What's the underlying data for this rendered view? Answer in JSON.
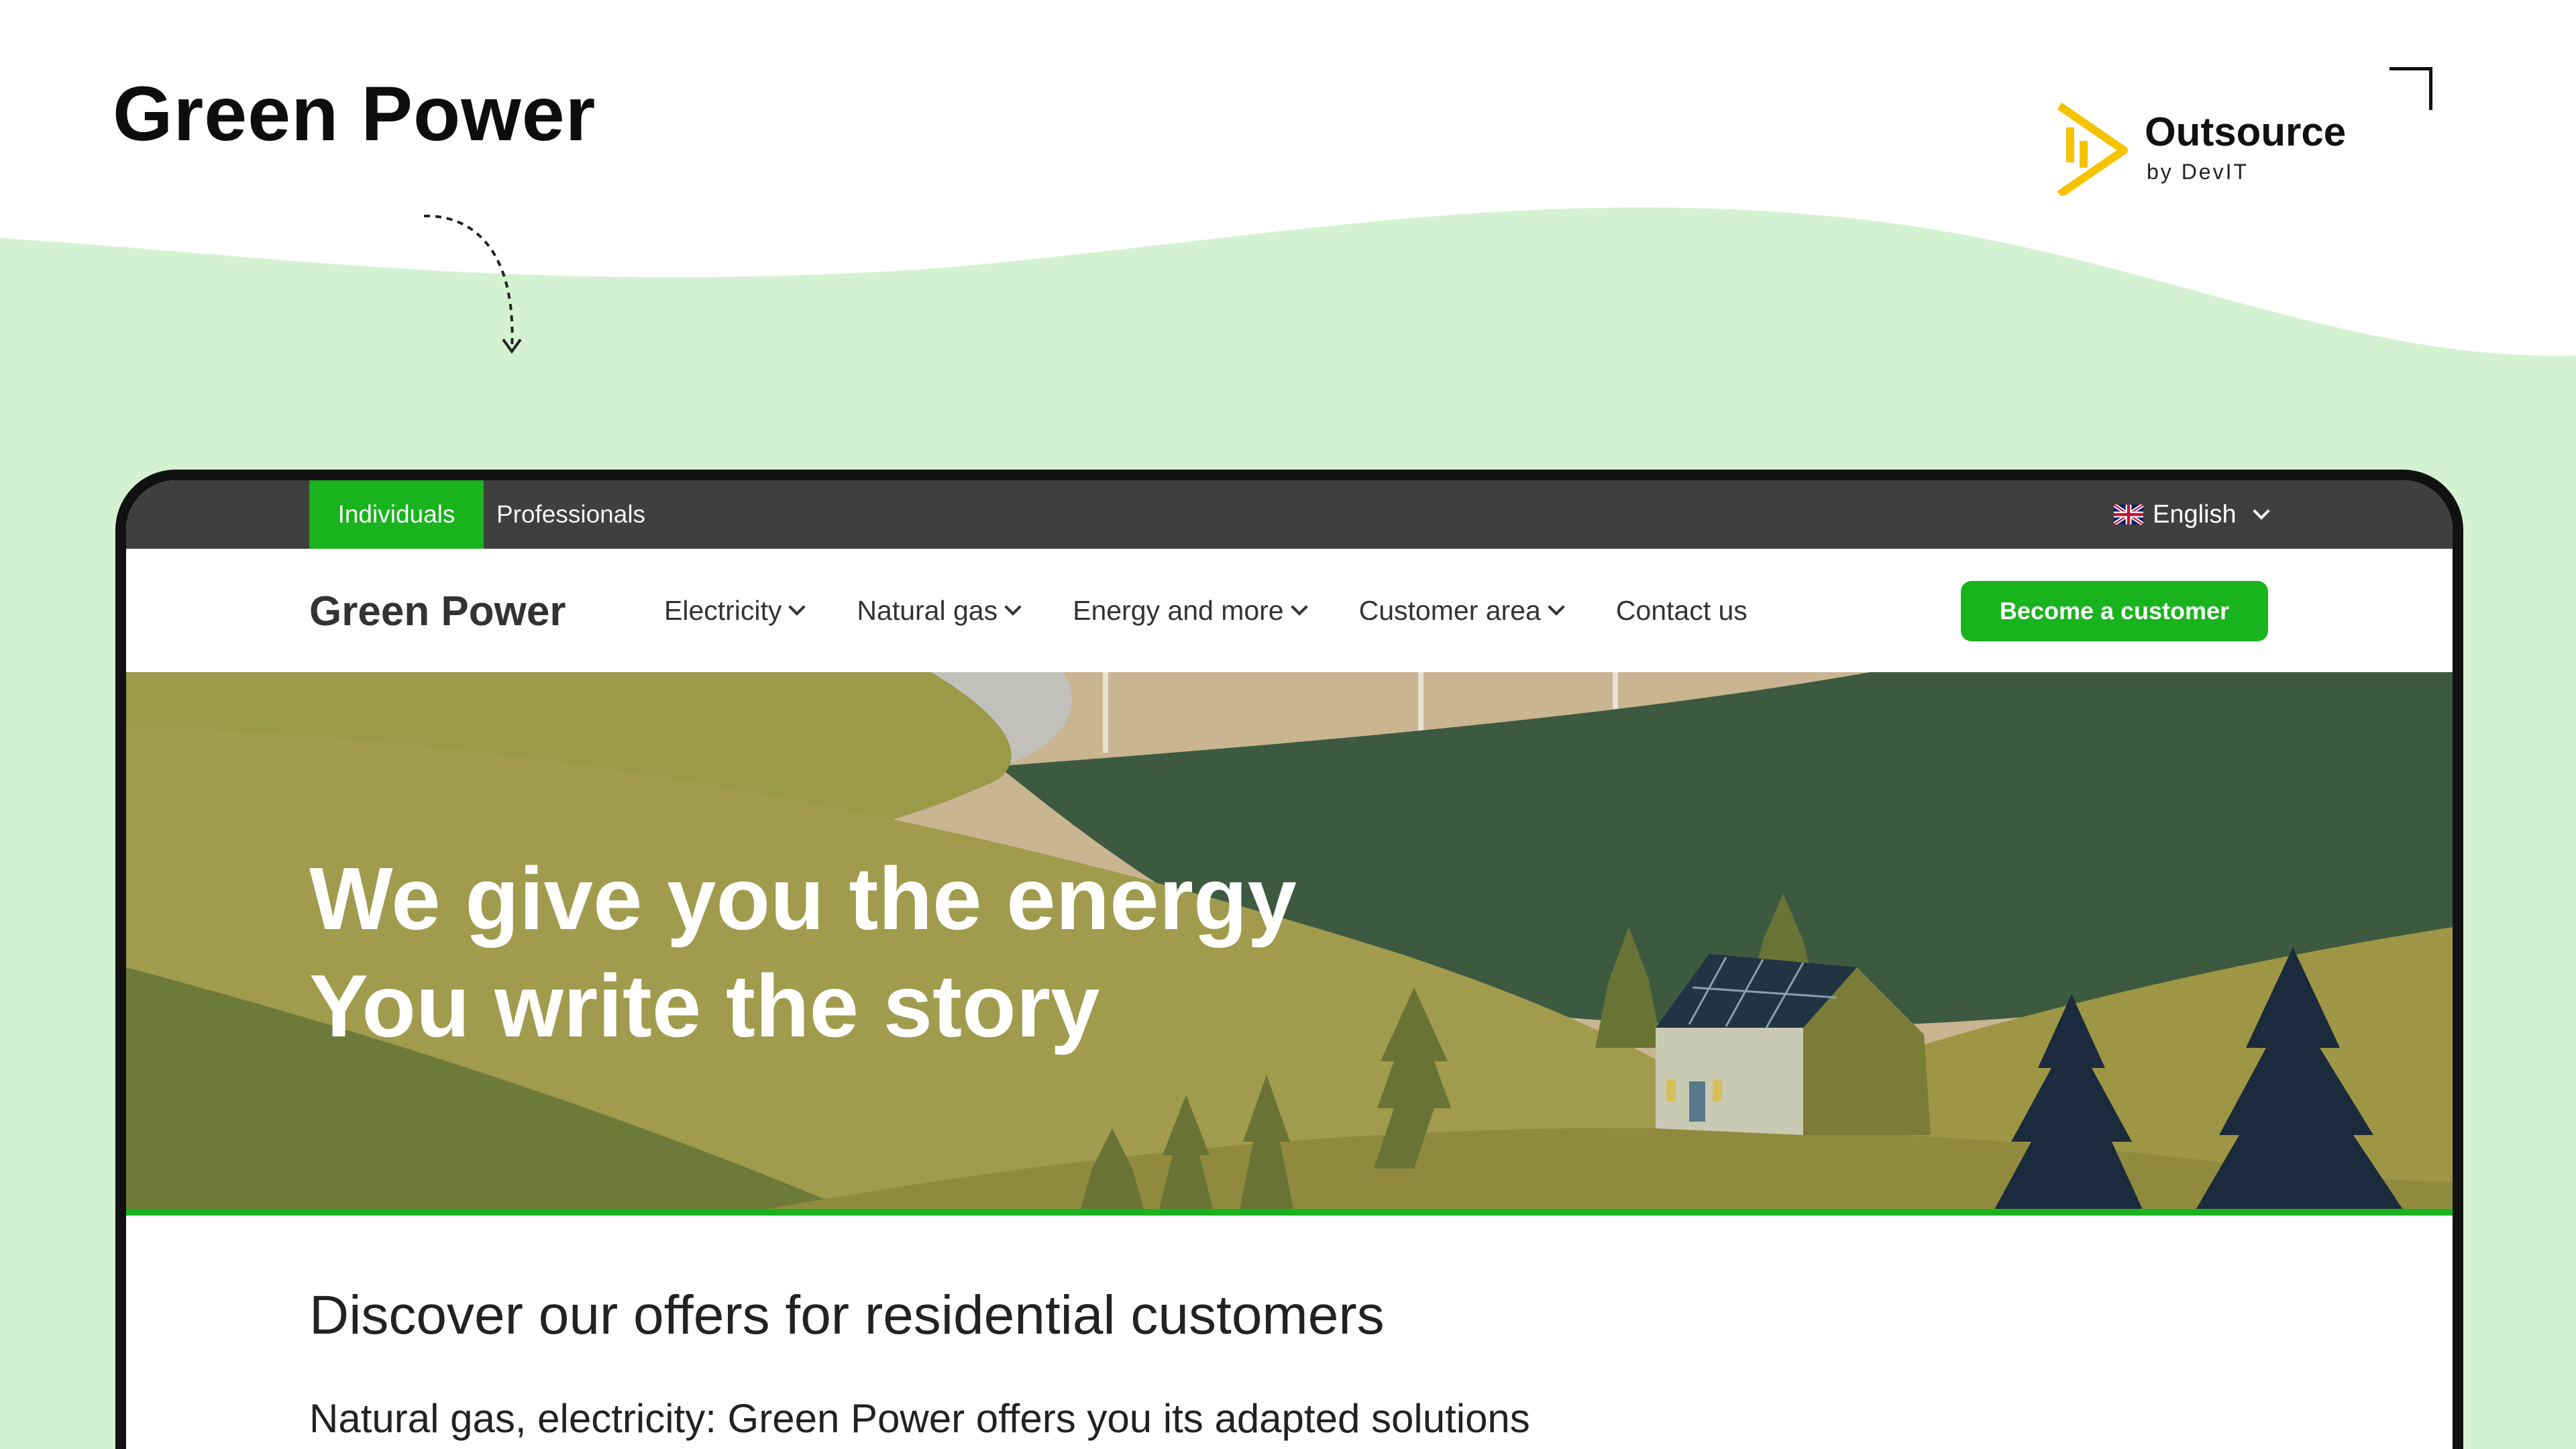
{
  "showcase": {
    "title": "Green Power",
    "brand_name": "Outsource",
    "brand_sub": "by DevIT",
    "background_color": "#d4f2d2"
  },
  "site": {
    "topbar": {
      "segments": [
        "Individuals",
        "Professionals"
      ],
      "active_segment": "Individuals",
      "language": "English"
    },
    "nav": {
      "logo": "Green Power",
      "items": [
        {
          "label": "Electricity",
          "dropdown": true
        },
        {
          "label": "Natural gas",
          "dropdown": true
        },
        {
          "label": "Energy and more",
          "dropdown": true
        },
        {
          "label": "Customer area",
          "dropdown": true
        },
        {
          "label": "Contact us",
          "dropdown": false
        }
      ],
      "cta": "Become a customer"
    },
    "hero": {
      "line1": "We give you the energy",
      "line2": "You write the story"
    },
    "section": {
      "heading": "Discover our offers for residential customers",
      "subheading": "Natural gas, electricity: Green Power offers you its adapted solutions"
    },
    "colors": {
      "accent": "#19b31e",
      "topbar": "#3f3f3d"
    }
  }
}
